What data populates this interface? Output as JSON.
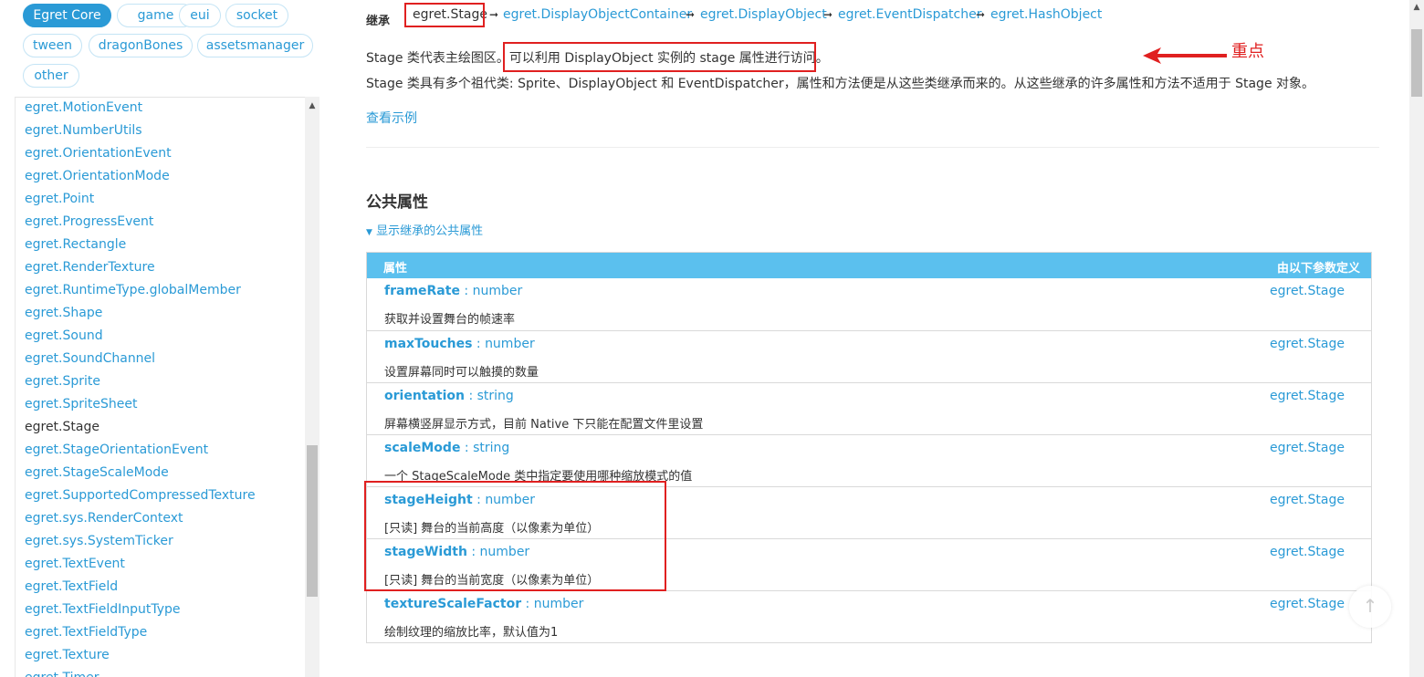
{
  "tags": [
    {
      "label": "Egret Core",
      "active": true
    },
    {
      "label": "game"
    },
    {
      "label": "eui"
    },
    {
      "label": "socket"
    },
    {
      "label": "tween"
    },
    {
      "label": "dragonBones"
    },
    {
      "label": "assetsmanager"
    },
    {
      "label": "other"
    }
  ],
  "nav": {
    "items": [
      "egret.MotionEvent",
      "egret.NumberUtils",
      "egret.OrientationEvent",
      "egret.OrientationMode",
      "egret.Point",
      "egret.ProgressEvent",
      "egret.Rectangle",
      "egret.RenderTexture",
      "egret.RuntimeType.globalMember",
      "egret.Shape",
      "egret.Sound",
      "egret.SoundChannel",
      "egret.Sprite",
      "egret.SpriteSheet",
      "egret.Stage",
      "egret.StageOrientationEvent",
      "egret.StageScaleMode",
      "egret.SupportedCompressedTexture",
      "egret.sys.RenderContext",
      "egret.sys.SystemTicker",
      "egret.TextEvent",
      "egret.TextField",
      "egret.TextFieldInputType",
      "egret.TextFieldType",
      "egret.Texture",
      "egret.Timer"
    ],
    "current": "egret.Stage"
  },
  "inherit": {
    "label": "继承",
    "chain": [
      "egret.Stage",
      "egret.DisplayObjectContainer",
      "egret.DisplayObject",
      "egret.EventDispatcher",
      "egret.HashObject"
    ]
  },
  "description": {
    "line1a": "Stage 类代表主绘图区。",
    "line1b": "可以利用 DisplayObject 实例的 stage 属性进行访问。",
    "line2": "Stage 类具有多个祖代类: Sprite、DisplayObject 和 EventDispatcher，属性和方法便是从这些类继承而来的。从这些继承的许多属性和方法不适用于 Stage 对象。",
    "example_link": "查看示例",
    "annotation": "重点"
  },
  "section": {
    "title": "公共属性",
    "toggle": "显示继承的公共属性"
  },
  "table": {
    "col_prop": "属性",
    "col_def": "由以下参数定义",
    "rows": [
      {
        "name": "frameRate",
        "type": "number",
        "desc": "获取并设置舞台的帧速率",
        "def": "egret.Stage"
      },
      {
        "name": "maxTouches",
        "type": "number",
        "desc": "设置屏幕同时可以触摸的数量",
        "def": "egret.Stage"
      },
      {
        "name": "orientation",
        "type": "string",
        "desc": "屏幕横竖屏显示方式，目前 Native 下只能在配置文件里设置",
        "def": "egret.Stage"
      },
      {
        "name": "scaleMode",
        "type": "string",
        "desc": "一个 StageScaleMode 类中指定要使用哪种缩放模式的值",
        "def": "egret.Stage"
      },
      {
        "name": "stageHeight",
        "type": "number",
        "desc": "[只读] 舞台的当前高度（以像素为单位）",
        "def": "egret.Stage"
      },
      {
        "name": "stageWidth",
        "type": "number",
        "desc": "[只读] 舞台的当前宽度（以像素为单位）",
        "def": "egret.Stage"
      },
      {
        "name": "textureScaleFactor",
        "type": "number",
        "desc": "绘制纹理的缩放比率，默认值为1",
        "def": "egret.Stage"
      }
    ]
  },
  "colors": {
    "accent": "#2a9ad6",
    "table_header": "#5bc0ee",
    "highlight": "#e02020"
  }
}
